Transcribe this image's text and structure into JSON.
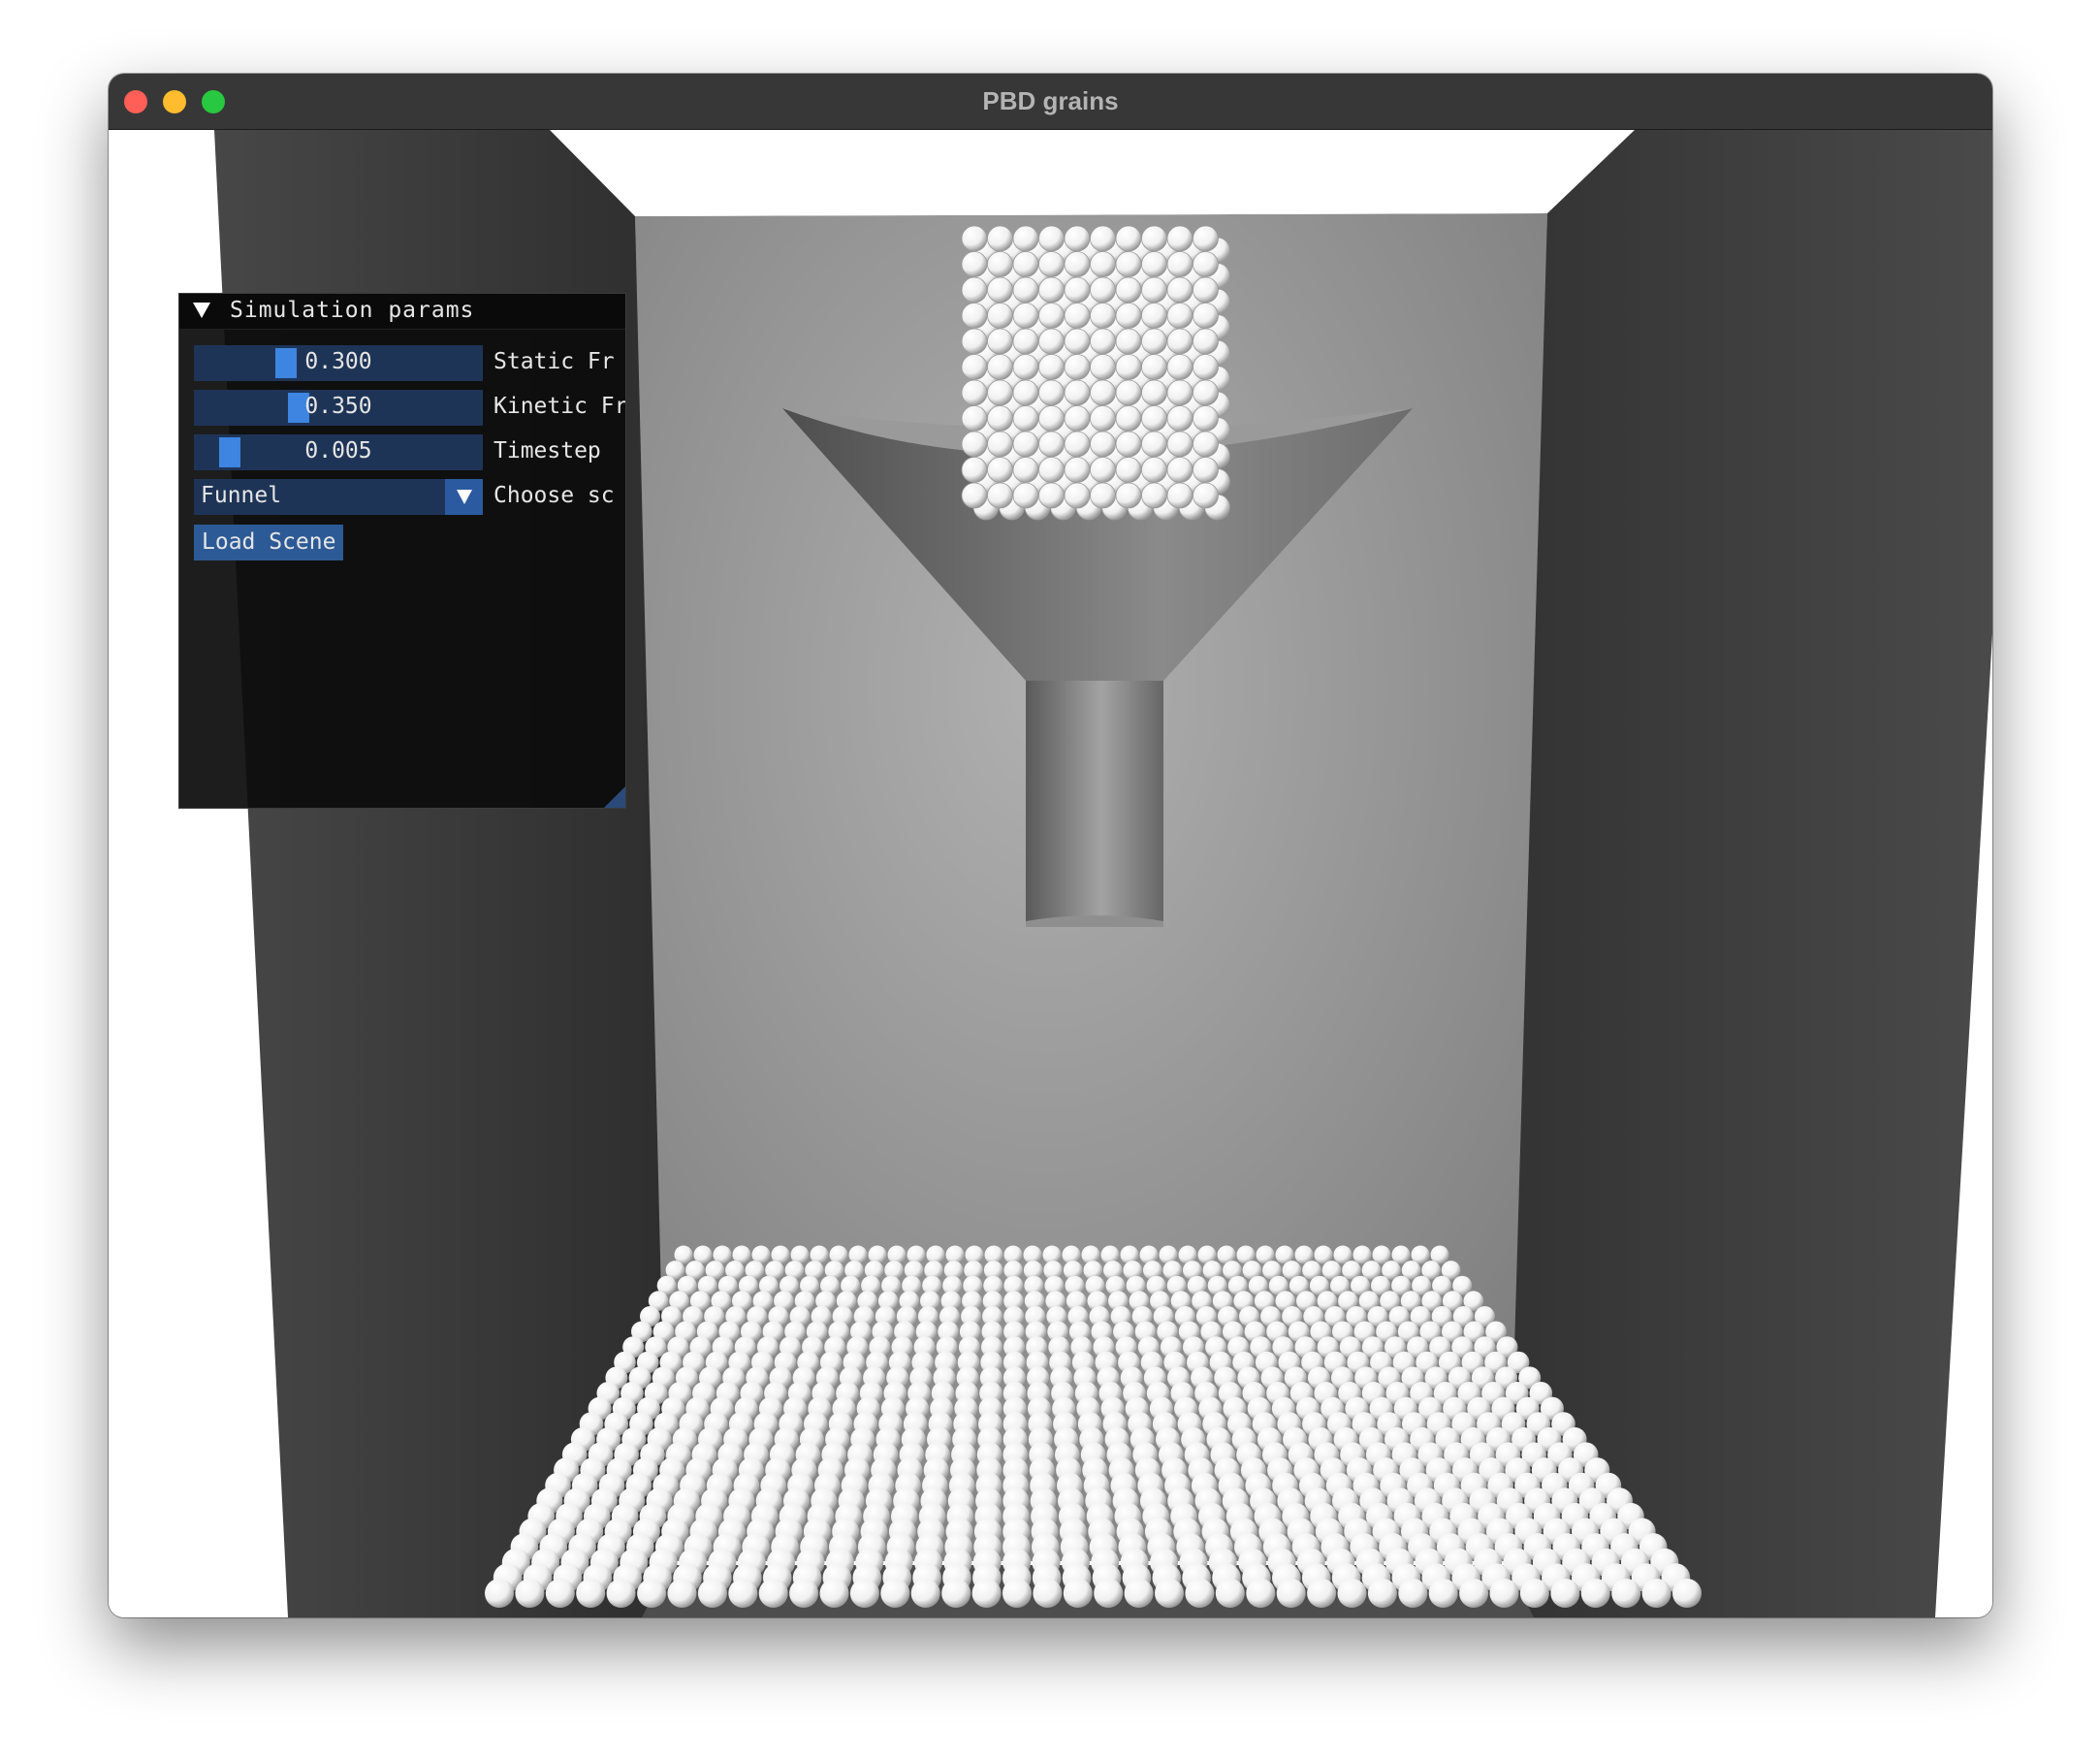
{
  "window": {
    "title": "PBD grains"
  },
  "panel": {
    "title": "Simulation params",
    "sliders": [
      {
        "value": "0.300",
        "label": "Static Fr",
        "fraction": 0.3
      },
      {
        "value": "0.350",
        "label": "Kinetic Fr",
        "fraction": 0.35
      },
      {
        "value": "0.005",
        "label": "Timestep",
        "fraction": 0.1
      }
    ],
    "combo": {
      "value": "Funnel",
      "label": "Choose sc"
    },
    "load_button": "Load Scene"
  },
  "colors": {
    "slider_frame": "#1e3457",
    "slider_grab": "#3d85e0",
    "button": "#2c5a96",
    "titlebar": "#373737"
  }
}
